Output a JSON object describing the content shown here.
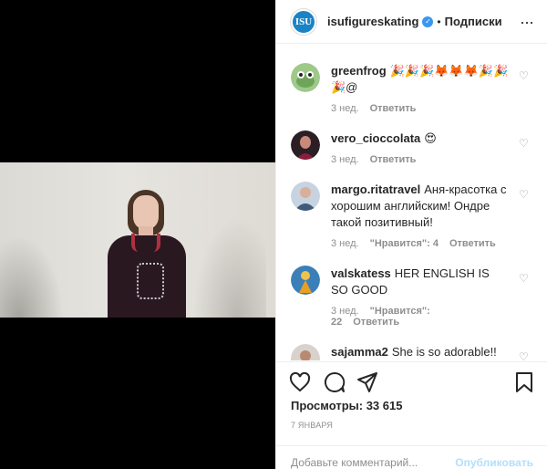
{
  "post": {
    "owner": "isufigureskating",
    "dot": "•",
    "follow": "Подписки",
    "logo_text": "ISU"
  },
  "comments": [
    {
      "username": "greenfrog",
      "text": "🎉🎉🎉🦊🦊🦊🎉🎉🎉@",
      "time": "3 нед.",
      "likes": "",
      "reply": "Ответить"
    },
    {
      "username": "vero_cioccolata",
      "text": "😍",
      "time": "3 нед.",
      "likes": "",
      "reply": "Ответить"
    },
    {
      "username": "margo.ritatravel",
      "text": "Аня-красотка с хорошим английским! Ондре такой позитивный!",
      "time": "3 нед.",
      "likes": "\"Нравится\": 4",
      "reply": "Ответить"
    },
    {
      "username": "valskatess",
      "text": "HER ENGLISH IS SO GOOD",
      "time": "3 нед.",
      "likes": "\"Нравится\": 22",
      "reply": "Ответить"
    },
    {
      "username": "sajamma2",
      "text": "She is so adorable!! big",
      "time": "",
      "likes": "",
      "reply": ""
    }
  ],
  "stats": {
    "views": "Просмотры: 33 615",
    "date": "7 ЯНВАРЯ"
  },
  "composer": {
    "placeholder": "Добавьте комментарий...",
    "publish": "Опубликовать"
  },
  "colors": {
    "verified": "#3897f0",
    "isu_blue": "#1a83c6",
    "publish_disabled": "#b2dffc"
  }
}
